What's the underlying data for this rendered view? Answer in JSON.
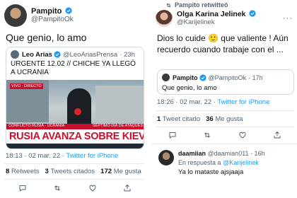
{
  "left": {
    "author": {
      "name": "Pampito",
      "handle": "@PampitoOk"
    },
    "text": "Que genio, lo amo",
    "quoted": {
      "name": "Leo Arias",
      "handle": "@LeoAriasPrensa",
      "time": "· 23h",
      "text": "URGENTE 12.02 // CHICHE YA LLEGÓ A UCRANIA",
      "video": {
        "live_badge": "VIVO · DIRECTO",
        "banner": "CONFLICTO RUSIA - UCRANIA",
        "subbanner": "SÉPTIMO DÍA DE ATAQUES",
        "headline": "RUSIA AVANZA SOBRE KIEV"
      }
    },
    "meta": {
      "time": "18:13 · 02 mar. 22 ·",
      "source": "Twitter for iPhone"
    },
    "stats": [
      {
        "count": "8",
        "label": "Retweets"
      },
      {
        "count": "3",
        "label": "Tweets citados"
      },
      {
        "count": "172",
        "label": "Me gusta"
      }
    ]
  },
  "right": {
    "retweeted_label": "Pampito retwitteó",
    "author": {
      "name": "Olga Karina Jelinek",
      "handle": "@Karijelinek"
    },
    "text": "Dios lo cuide 🙂 que valiente ! Aún recuerdo cuando trabaje con el ...",
    "quoted": {
      "name": "Pampito",
      "handle": "@PampitoOk",
      "time": "· 17h",
      "text": "Que genio, lo amo"
    },
    "meta": {
      "time": "18:26 · 02 mar. 22 ·",
      "source": "Twitter for iPhone"
    },
    "stats": [
      {
        "count": "1",
        "label": "Tweet citado"
      },
      {
        "count": "36",
        "label": "Me gusta"
      }
    ],
    "reply": {
      "name": "daamiian",
      "handle": "@daamian011",
      "time": "· 16h",
      "reply_to_prefix": "En respuesta a",
      "reply_to": "@Karijelinek",
      "text": "Ya lo mataste ajsjaaja"
    }
  },
  "colors": {
    "accent": "#1d9bf0",
    "muted": "#536471",
    "headline_red": "#c8102e"
  }
}
